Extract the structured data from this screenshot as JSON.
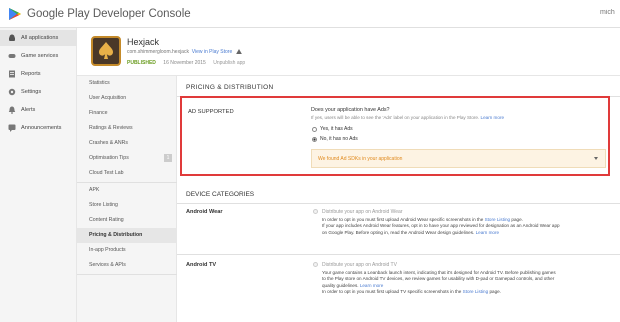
{
  "topbar": {
    "brand": "Google Play Developer Console",
    "user": "mich"
  },
  "leftnav": {
    "items": [
      {
        "label": "All applications",
        "icon": "android-icon"
      },
      {
        "label": "Game services",
        "icon": "gamepad-icon"
      },
      {
        "label": "Reports",
        "icon": "report-icon"
      },
      {
        "label": "Settings",
        "icon": "gear-icon"
      },
      {
        "label": "Alerts",
        "icon": "alert-icon"
      },
      {
        "label": "Announcements",
        "icon": "announcement-icon"
      }
    ]
  },
  "app": {
    "name": "Hexjack",
    "package": "com.shimmergloom.hexjack",
    "view_link": "View in Play Store",
    "status": "PUBLISHED",
    "date": "16 November 2015",
    "unpublish": "Unpublish app"
  },
  "subnav": {
    "items": [
      {
        "label": "Statistics"
      },
      {
        "label": "User Acquisition"
      },
      {
        "label": "Finance"
      },
      {
        "label": "Ratings & Reviews"
      },
      {
        "label": "Crashes & ANRs"
      },
      {
        "label": "Optimisation Tips",
        "badge": "1"
      },
      {
        "label": "Cloud Test Lab"
      },
      {
        "label": "APK"
      },
      {
        "label": "Store Listing"
      },
      {
        "label": "Content Rating"
      },
      {
        "label": "Pricing & Distribution"
      },
      {
        "label": "In-app Products"
      },
      {
        "label": "Services & APIs"
      }
    ],
    "active_index": 10
  },
  "main": {
    "section_title": "PRICING & DISTRIBUTION",
    "ads": {
      "label": "AD SUPPORTED",
      "question": "Does your application have Ads?",
      "sub_text": "If yes, users will be able to see the 'Ads' label on your application in the Play Store.",
      "learn_more": "Learn more",
      "option_yes": "Yes, it has Ads",
      "option_no": "No, it has no Ads",
      "selected": "no",
      "dropdown_text": "We found Ad SDKs in your application"
    },
    "device_title": "DEVICE CATEGORIES",
    "wear": {
      "name": "Android Wear",
      "option": "Distribute your app on Android Wear",
      "line1_a": "In order to opt in you must first upload Android Wear specific screenshots in the",
      "line1_link": "Store Listing",
      "line1_b": "page.",
      "line2": "If your app includes Android Wear features, opt in to have your app reviewed for designation as an Android Wear app",
      "line3_a": "on Google Play. Before opting in, read the Android Wear design guidelines.",
      "line3_link": "Learn more"
    },
    "tv": {
      "name": "Android TV",
      "option": "Distribute your app on Android TV",
      "line1": "Your game contains a Leanback launch intent, indicating that it's designed for Android TV. Before publishing games",
      "line2": "to the Play store on Android TV devices, we review games for usability with D-pad or Gamepad controls, and other",
      "line3_a": "quality guidelines.",
      "line3_link": "Learn more",
      "line4_a": "In order to opt in you must first upload TV specific screenshots in the",
      "line4_link": "Store Listing",
      "line4_b": "page."
    }
  },
  "colors": {
    "highlight_border": "#e03a3a",
    "published": "#6a9c20",
    "link": "#4a7bd0",
    "warning": "#e08a1e"
  }
}
